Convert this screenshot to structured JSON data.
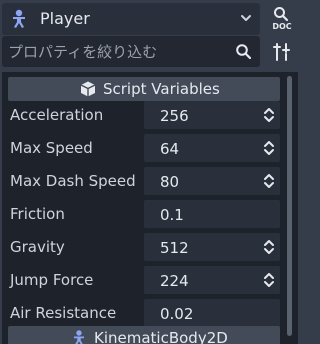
{
  "header": {
    "node_name": "Player",
    "doc_label": "DOC"
  },
  "filter": {
    "placeholder": "プロパティを絞り込む"
  },
  "section": {
    "title": "Script Variables"
  },
  "properties": [
    {
      "label": "Acceleration",
      "value": "256",
      "spinner": true
    },
    {
      "label": "Max Speed",
      "value": "64",
      "spinner": true
    },
    {
      "label": "Max Dash Speed",
      "value": "80",
      "spinner": true
    },
    {
      "label": "Friction",
      "value": "0.1",
      "spinner": false
    },
    {
      "label": "Gravity",
      "value": "512",
      "spinner": true
    },
    {
      "label": "Jump Force",
      "value": "224",
      "spinner": true
    },
    {
      "label": "Air Resistance",
      "value": "0.02",
      "spinner": false
    }
  ],
  "base_section": {
    "title": "KinematicBody2D"
  },
  "colors": {
    "node_icon": "#8da5f3",
    "panel_bg": "#1e232b",
    "header_bg": "#434b58"
  }
}
